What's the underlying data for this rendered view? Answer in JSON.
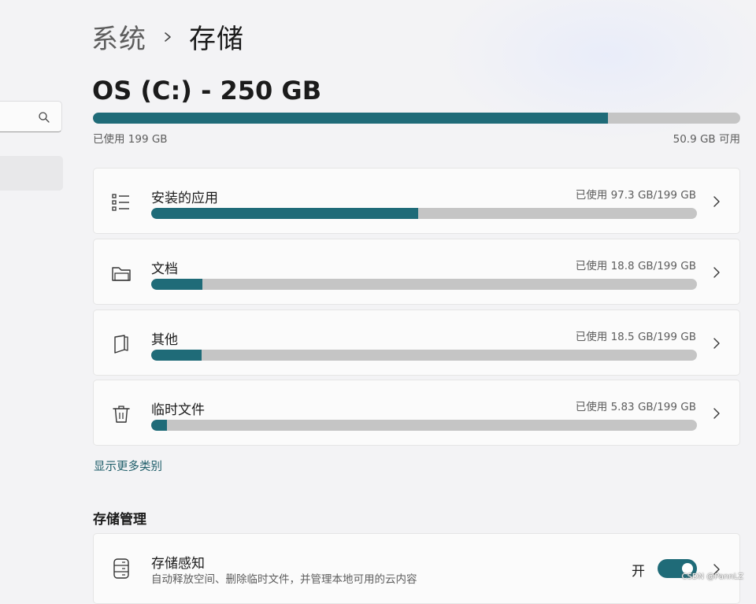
{
  "breadcrumb": {
    "parent": "系统",
    "current": "存储"
  },
  "drive": {
    "title": "OS (C:) - 250 GB",
    "used_label": "已使用 199 GB",
    "free_label": "50.9 GB 可用",
    "used_fraction": 0.796
  },
  "categories": [
    {
      "label": "安装的应用",
      "usage": "已使用 97.3 GB/199 GB",
      "used_fraction": 0.489,
      "icon": "list-icon"
    },
    {
      "label": "文档",
      "usage": "已使用 18.8 GB/199 GB",
      "used_fraction": 0.094,
      "icon": "folder-icon"
    },
    {
      "label": "其他",
      "usage": "已使用 18.5 GB/199 GB",
      "used_fraction": 0.093,
      "icon": "files-icon"
    },
    {
      "label": "临时文件",
      "usage": "已使用 5.83 GB/199 GB",
      "used_fraction": 0.029,
      "icon": "trash-icon"
    }
  ],
  "show_more": "显示更多类别",
  "storage_management": {
    "title": "存储管理",
    "storage_sense": {
      "title": "存储感知",
      "description": "自动释放空间、删除临时文件，并管理本地可用的云内容",
      "toggle_label": "开",
      "toggle_on": true,
      "icon": "hard-drive-icon"
    }
  },
  "watermark": "CSDN @PannLZ",
  "colors": {
    "accent": "#1f6b78",
    "track": "#c5c5c5",
    "background": "#f3f3f5",
    "card": "#fbfbfb"
  }
}
